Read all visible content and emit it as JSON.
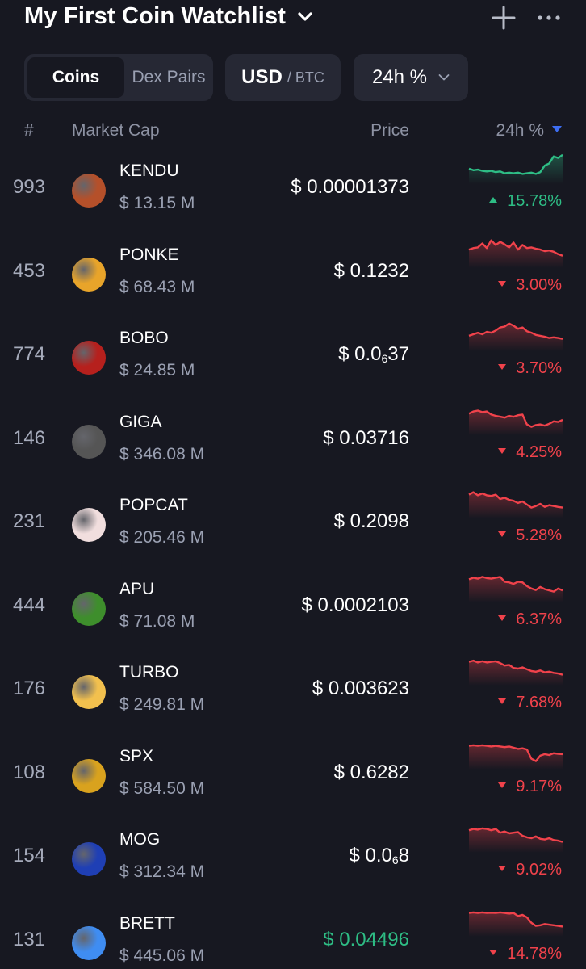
{
  "header": {
    "title": "My First Coin Watchlist"
  },
  "controls": {
    "segments": [
      "Coins",
      "Dex Pairs"
    ],
    "currency_main": "USD",
    "currency_sep": "/ BTC",
    "period": "24h %"
  },
  "columns": {
    "rank": "#",
    "market_cap": "Market Cap",
    "price": "Price",
    "change": "24h %"
  },
  "colors": {
    "up": "#2ebd85",
    "down": "#f0424b",
    "background": "#171821",
    "sort_arrow": "#3d6df2"
  },
  "coins": [
    {
      "rank": "993",
      "symbol": "KENDU",
      "market_cap": "$ 13.15 M",
      "price": "$ 0.00001373",
      "price_sub": "",
      "price_tail": "",
      "change": "15.78%",
      "direction": "up",
      "spark": [
        0.45,
        0.4,
        0.42,
        0.38,
        0.36,
        0.38,
        0.34,
        0.36,
        0.3,
        0.32,
        0.3,
        0.32,
        0.28,
        0.3,
        0.32,
        0.28,
        0.34,
        0.55,
        0.62,
        0.85,
        0.8,
        0.9
      ],
      "avatar_color": "#b5502a"
    },
    {
      "rank": "453",
      "symbol": "PONKE",
      "market_cap": "$ 68.43 M",
      "price": "$ 0.1232",
      "price_sub": "",
      "price_tail": "",
      "change": "3.00%",
      "direction": "down",
      "spark": [
        0.55,
        0.6,
        0.62,
        0.75,
        0.6,
        0.85,
        0.7,
        0.8,
        0.72,
        0.62,
        0.78,
        0.55,
        0.7,
        0.6,
        0.62,
        0.58,
        0.55,
        0.5,
        0.52,
        0.48,
        0.4,
        0.35
      ],
      "avatar_color": "#e8a42a"
    },
    {
      "rank": "774",
      "symbol": "BOBO",
      "market_cap": "$ 24.85 M",
      "price": "$ 0.0",
      "price_sub": "6",
      "price_tail": "37",
      "change": "3.70%",
      "direction": "down",
      "spark": [
        0.45,
        0.5,
        0.55,
        0.5,
        0.58,
        0.55,
        0.62,
        0.72,
        0.75,
        0.85,
        0.78,
        0.68,
        0.72,
        0.6,
        0.55,
        0.48,
        0.45,
        0.42,
        0.38,
        0.4,
        0.38,
        0.35
      ],
      "avatar_color": "#b6201d"
    },
    {
      "rank": "146",
      "symbol": "GIGA",
      "market_cap": "$ 346.08 M",
      "price": "$ 0.03716",
      "price_sub": "",
      "price_tail": "",
      "change": "4.25%",
      "direction": "down",
      "spark": [
        0.65,
        0.72,
        0.75,
        0.7,
        0.72,
        0.62,
        0.58,
        0.55,
        0.52,
        0.58,
        0.55,
        0.6,
        0.62,
        0.3,
        0.22,
        0.28,
        0.3,
        0.26,
        0.32,
        0.4,
        0.38,
        0.45
      ],
      "avatar_color": "#555555"
    },
    {
      "rank": "231",
      "symbol": "POPCAT",
      "market_cap": "$ 205.46 M",
      "price": "$ 0.2098",
      "price_sub": "",
      "price_tail": "",
      "change": "5.28%",
      "direction": "down",
      "spark": [
        0.72,
        0.8,
        0.7,
        0.76,
        0.7,
        0.68,
        0.72,
        0.58,
        0.62,
        0.55,
        0.52,
        0.45,
        0.5,
        0.4,
        0.3,
        0.35,
        0.42,
        0.32,
        0.38,
        0.35,
        0.32,
        0.3
      ],
      "avatar_color": "#f1dede"
    },
    {
      "rank": "444",
      "symbol": "APU",
      "market_cap": "$ 71.08 M",
      "price": "$ 0.0002103",
      "price_sub": "",
      "price_tail": "",
      "change": "6.37%",
      "direction": "down",
      "spark": [
        0.7,
        0.75,
        0.72,
        0.78,
        0.74,
        0.72,
        0.75,
        0.78,
        0.62,
        0.6,
        0.55,
        0.62,
        0.6,
        0.48,
        0.4,
        0.35,
        0.45,
        0.38,
        0.34,
        0.3,
        0.4,
        0.34
      ],
      "avatar_color": "#3e8e2c"
    },
    {
      "rank": "176",
      "symbol": "TURBO",
      "market_cap": "$ 249.81 M",
      "price": "$ 0.003623",
      "price_sub": "",
      "price_tail": "",
      "change": "7.68%",
      "direction": "down",
      "spark": [
        0.72,
        0.76,
        0.7,
        0.74,
        0.7,
        0.72,
        0.74,
        0.68,
        0.6,
        0.62,
        0.52,
        0.5,
        0.54,
        0.48,
        0.42,
        0.4,
        0.44,
        0.38,
        0.4,
        0.36,
        0.34,
        0.3
      ],
      "avatar_color": "#f2c04e"
    },
    {
      "rank": "108",
      "symbol": "SPX",
      "market_cap": "$ 584.50 M",
      "price": "$ 0.6282",
      "price_sub": "",
      "price_tail": "",
      "change": "9.17%",
      "direction": "down",
      "spark": [
        0.72,
        0.74,
        0.72,
        0.74,
        0.72,
        0.7,
        0.72,
        0.7,
        0.68,
        0.7,
        0.66,
        0.62,
        0.64,
        0.6,
        0.3,
        0.22,
        0.4,
        0.45,
        0.42,
        0.48,
        0.46,
        0.45
      ],
      "avatar_color": "#d9a21e"
    },
    {
      "rank": "154",
      "symbol": "MOG",
      "market_cap": "$ 312.34 M",
      "price": "$ 0.0",
      "price_sub": "6",
      "price_tail": "8",
      "change": "9.02%",
      "direction": "down",
      "spark": [
        0.68,
        0.72,
        0.7,
        0.74,
        0.72,
        0.68,
        0.72,
        0.6,
        0.64,
        0.58,
        0.6,
        0.62,
        0.5,
        0.45,
        0.42,
        0.48,
        0.4,
        0.38,
        0.42,
        0.36,
        0.34,
        0.3
      ],
      "avatar_color": "#1f3fb5"
    },
    {
      "rank": "131",
      "symbol": "BRETT",
      "market_cap": "$ 445.06 M",
      "price": "$ 0.04496",
      "price_sub": "",
      "price_tail": "",
      "change": "14.78%",
      "direction": "down",
      "price_color": "#2ebd85",
      "spark": [
        0.72,
        0.74,
        0.72,
        0.74,
        0.72,
        0.73,
        0.72,
        0.74,
        0.72,
        0.7,
        0.72,
        0.62,
        0.66,
        0.58,
        0.4,
        0.3,
        0.32,
        0.36,
        0.34,
        0.32,
        0.3,
        0.28
      ],
      "avatar_color": "#3f8df2"
    }
  ]
}
